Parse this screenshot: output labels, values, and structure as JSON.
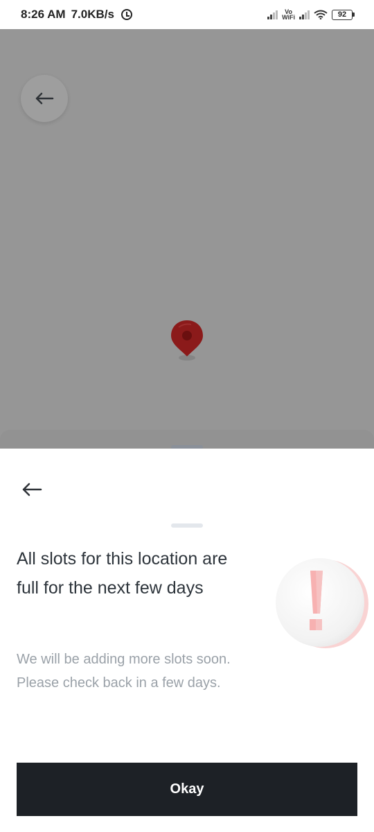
{
  "status_bar": {
    "time": "8:26 AM",
    "speed": "7.0KB/s",
    "vowifi_top": "Vo",
    "vowifi_bottom": "WiFi",
    "battery": "92"
  },
  "map": {
    "overlay_color": "#969696",
    "pin_color": "#8b1a1a"
  },
  "sheet": {
    "title": "All slots for this location are full for the next few days",
    "subtitle": "We will be adding more slots soon. Please check back in a few days.",
    "ok_label": "Okay",
    "alert_icon": "exclamation-icon"
  }
}
